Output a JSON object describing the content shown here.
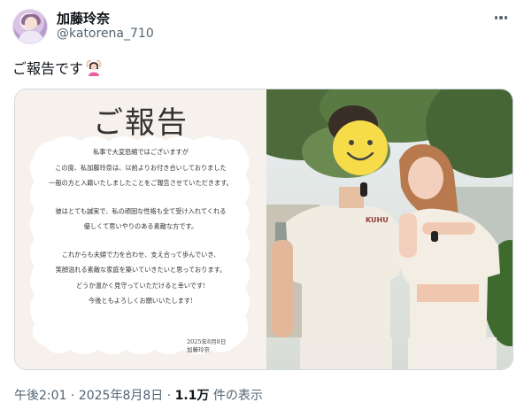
{
  "author": {
    "display_name": "加藤玲奈",
    "handle": "@katorena_710"
  },
  "post": {
    "text": "ご報告です",
    "emoji_icon": "woman-gesturing-ok-icon"
  },
  "notice_image": {
    "title": "ご報告",
    "lines": [
      "私事で大変恐縮ではございますが",
      "この度、私加藤玲奈は、以前よりお付き合いしておりました",
      "一般の方と入籍いたしましたことをご報告させていただきます。",
      "",
      "彼はとても誠実で、私の頑固な性格も全て受け入れてくれる",
      "優しくて思いやりのある素敵な方です。",
      "",
      "これからも夫婦で力を合わせ、支え合って歩んでいき、",
      "笑顔溢れる素敵な家庭を築いていきたいと思っております。",
      "どうか温かく見守っていただけると幸いです!",
      "今後ともよろしくお願いいたします!"
    ],
    "date": "2025年8月8日",
    "signature": "加藤玲奈"
  },
  "photo": {
    "shirt_text": "KUHU",
    "face_cover_icon": "smiley-face-icon"
  },
  "meta": {
    "time": "午後2:01",
    "separator": " · ",
    "date": "2025年8月8日",
    "views_count": "1.1万",
    "views_label": " 件の表示"
  },
  "colors": {
    "text_primary": "#0f1419",
    "text_secondary": "#536471",
    "border": "#cfd9de",
    "notice_bg": "#f6f1ec",
    "smiley_yellow": "#f7dc4a"
  }
}
